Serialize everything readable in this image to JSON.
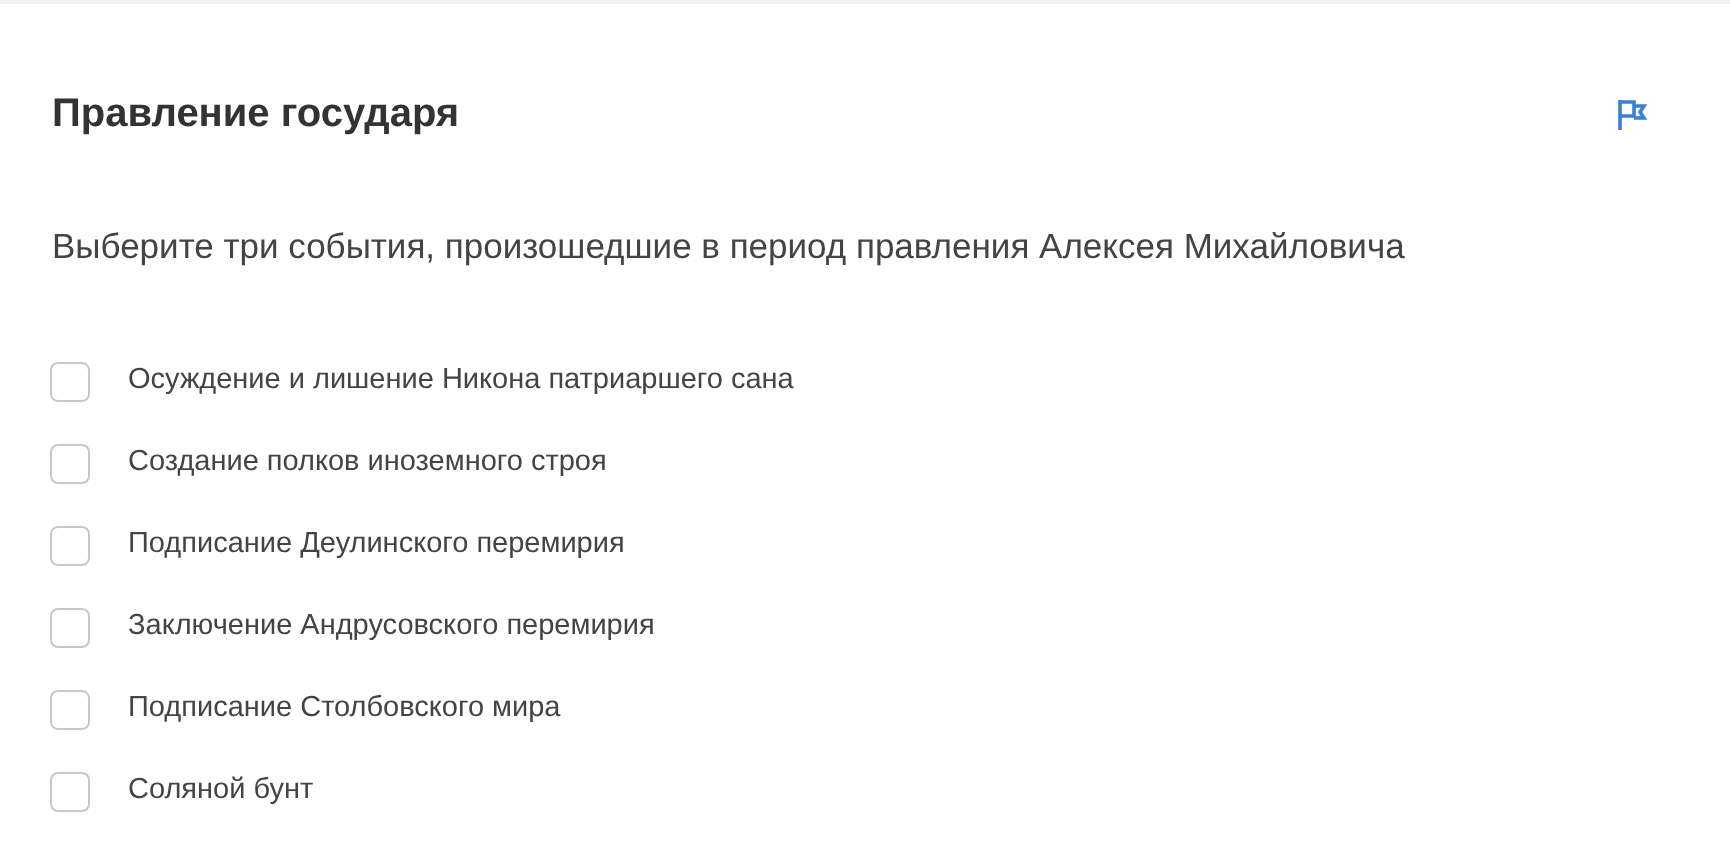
{
  "title": "Правление государя",
  "question": "Выберите три события, произошедшие в период правления Алексея Михайловича",
  "options": [
    {
      "label": "Осуждение и лишение Никона патриаршего сана",
      "checked": false
    },
    {
      "label": "Создание полков иноземного строя",
      "checked": false
    },
    {
      "label": "Подписание Деулинского перемирия",
      "checked": false
    },
    {
      "label": "Заключение Андрусовского перемирия",
      "checked": false
    },
    {
      "label": "Подписание Столбовского мира",
      "checked": false
    },
    {
      "label": "Соляной бунт",
      "checked": false
    }
  ]
}
